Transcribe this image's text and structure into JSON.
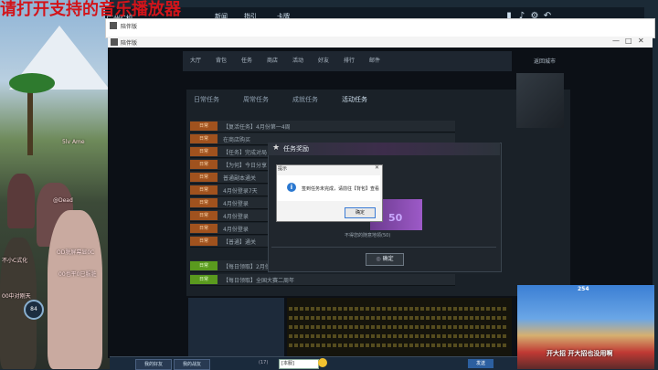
{
  "overlay": {
    "banner": "请打开支持的音乐播放器"
  },
  "left_stream": {
    "chat": [
      {
        "text": "5lv Ame"
      },
      {
        "text": "@Dead"
      },
      {
        "text": "OD脱屏幕显0C"
      },
      {
        "text": "不小C式化"
      },
      {
        "text": "00也平0已服脏"
      },
      {
        "text": "00中对刚天"
      }
    ],
    "level": "84",
    "watermark": "广州C机"
  },
  "top_bar": {
    "tabs": [
      "新闻",
      "指引",
      "卡牌"
    ],
    "icons": [
      "phone-icon",
      "music-icon",
      "gear-icon",
      "back-icon"
    ]
  },
  "outer_window": {
    "title": "陪伴版"
  },
  "inner_window": {
    "title": "陪伴版",
    "controls": [
      "—",
      "□",
      "✕"
    ]
  },
  "game": {
    "nav_tabs": [
      "大厅",
      "背包",
      "任务",
      "商店",
      "活动",
      "好友",
      "排行",
      "邮件",
      "返回城市"
    ],
    "sub_tabs": [
      "日常任务",
      "周常任务",
      "成就任务",
      "活动任务"
    ],
    "quests": [
      {
        "badge": "日常",
        "text": "【复活任务】4月份第一4周"
      },
      {
        "badge": "日常",
        "text": "在商店购买"
      },
      {
        "badge": "日常",
        "text": "【任务】完成对局"
      },
      {
        "badge": "日常",
        "text": "【为何】今日分享"
      },
      {
        "badge": "日常",
        "text": "普通副本通关"
      },
      {
        "badge": "日常",
        "text": "4月份登录7天"
      },
      {
        "badge": "日常",
        "text": "4月份登录"
      },
      {
        "badge": "日常",
        "text": "4月份登录"
      },
      {
        "badge": "日常",
        "text": "4月份登录"
      },
      {
        "badge": "日常",
        "text": "【普通】通关"
      },
      {
        "badge": "日常",
        "text": "【每日领取】2月份"
      },
      {
        "badge": "日常",
        "text": "【每日领取】全国大赛二周年"
      }
    ]
  },
  "reward_modal": {
    "title": "任务奖励",
    "reward_value": "50",
    "reward_desc": "不得您的随意地领(50)",
    "confirm_label": "确定"
  },
  "system_dialog": {
    "title": "提示",
    "message": "签到任务未完成，请前往【背包】查看",
    "ok_label": "确定"
  },
  "bottom_bar": {
    "my_friends": "我的好友",
    "my_team": "我的战友",
    "count": "(17)",
    "channel": "[本服]",
    "send_label": "发送"
  },
  "webcam": {
    "caption": "开大招 开大招也没用啊",
    "number": "254"
  },
  "colors": {
    "banner": "#d2141a",
    "quest_badge": "#a0521e",
    "accent": "#2b78d0"
  }
}
